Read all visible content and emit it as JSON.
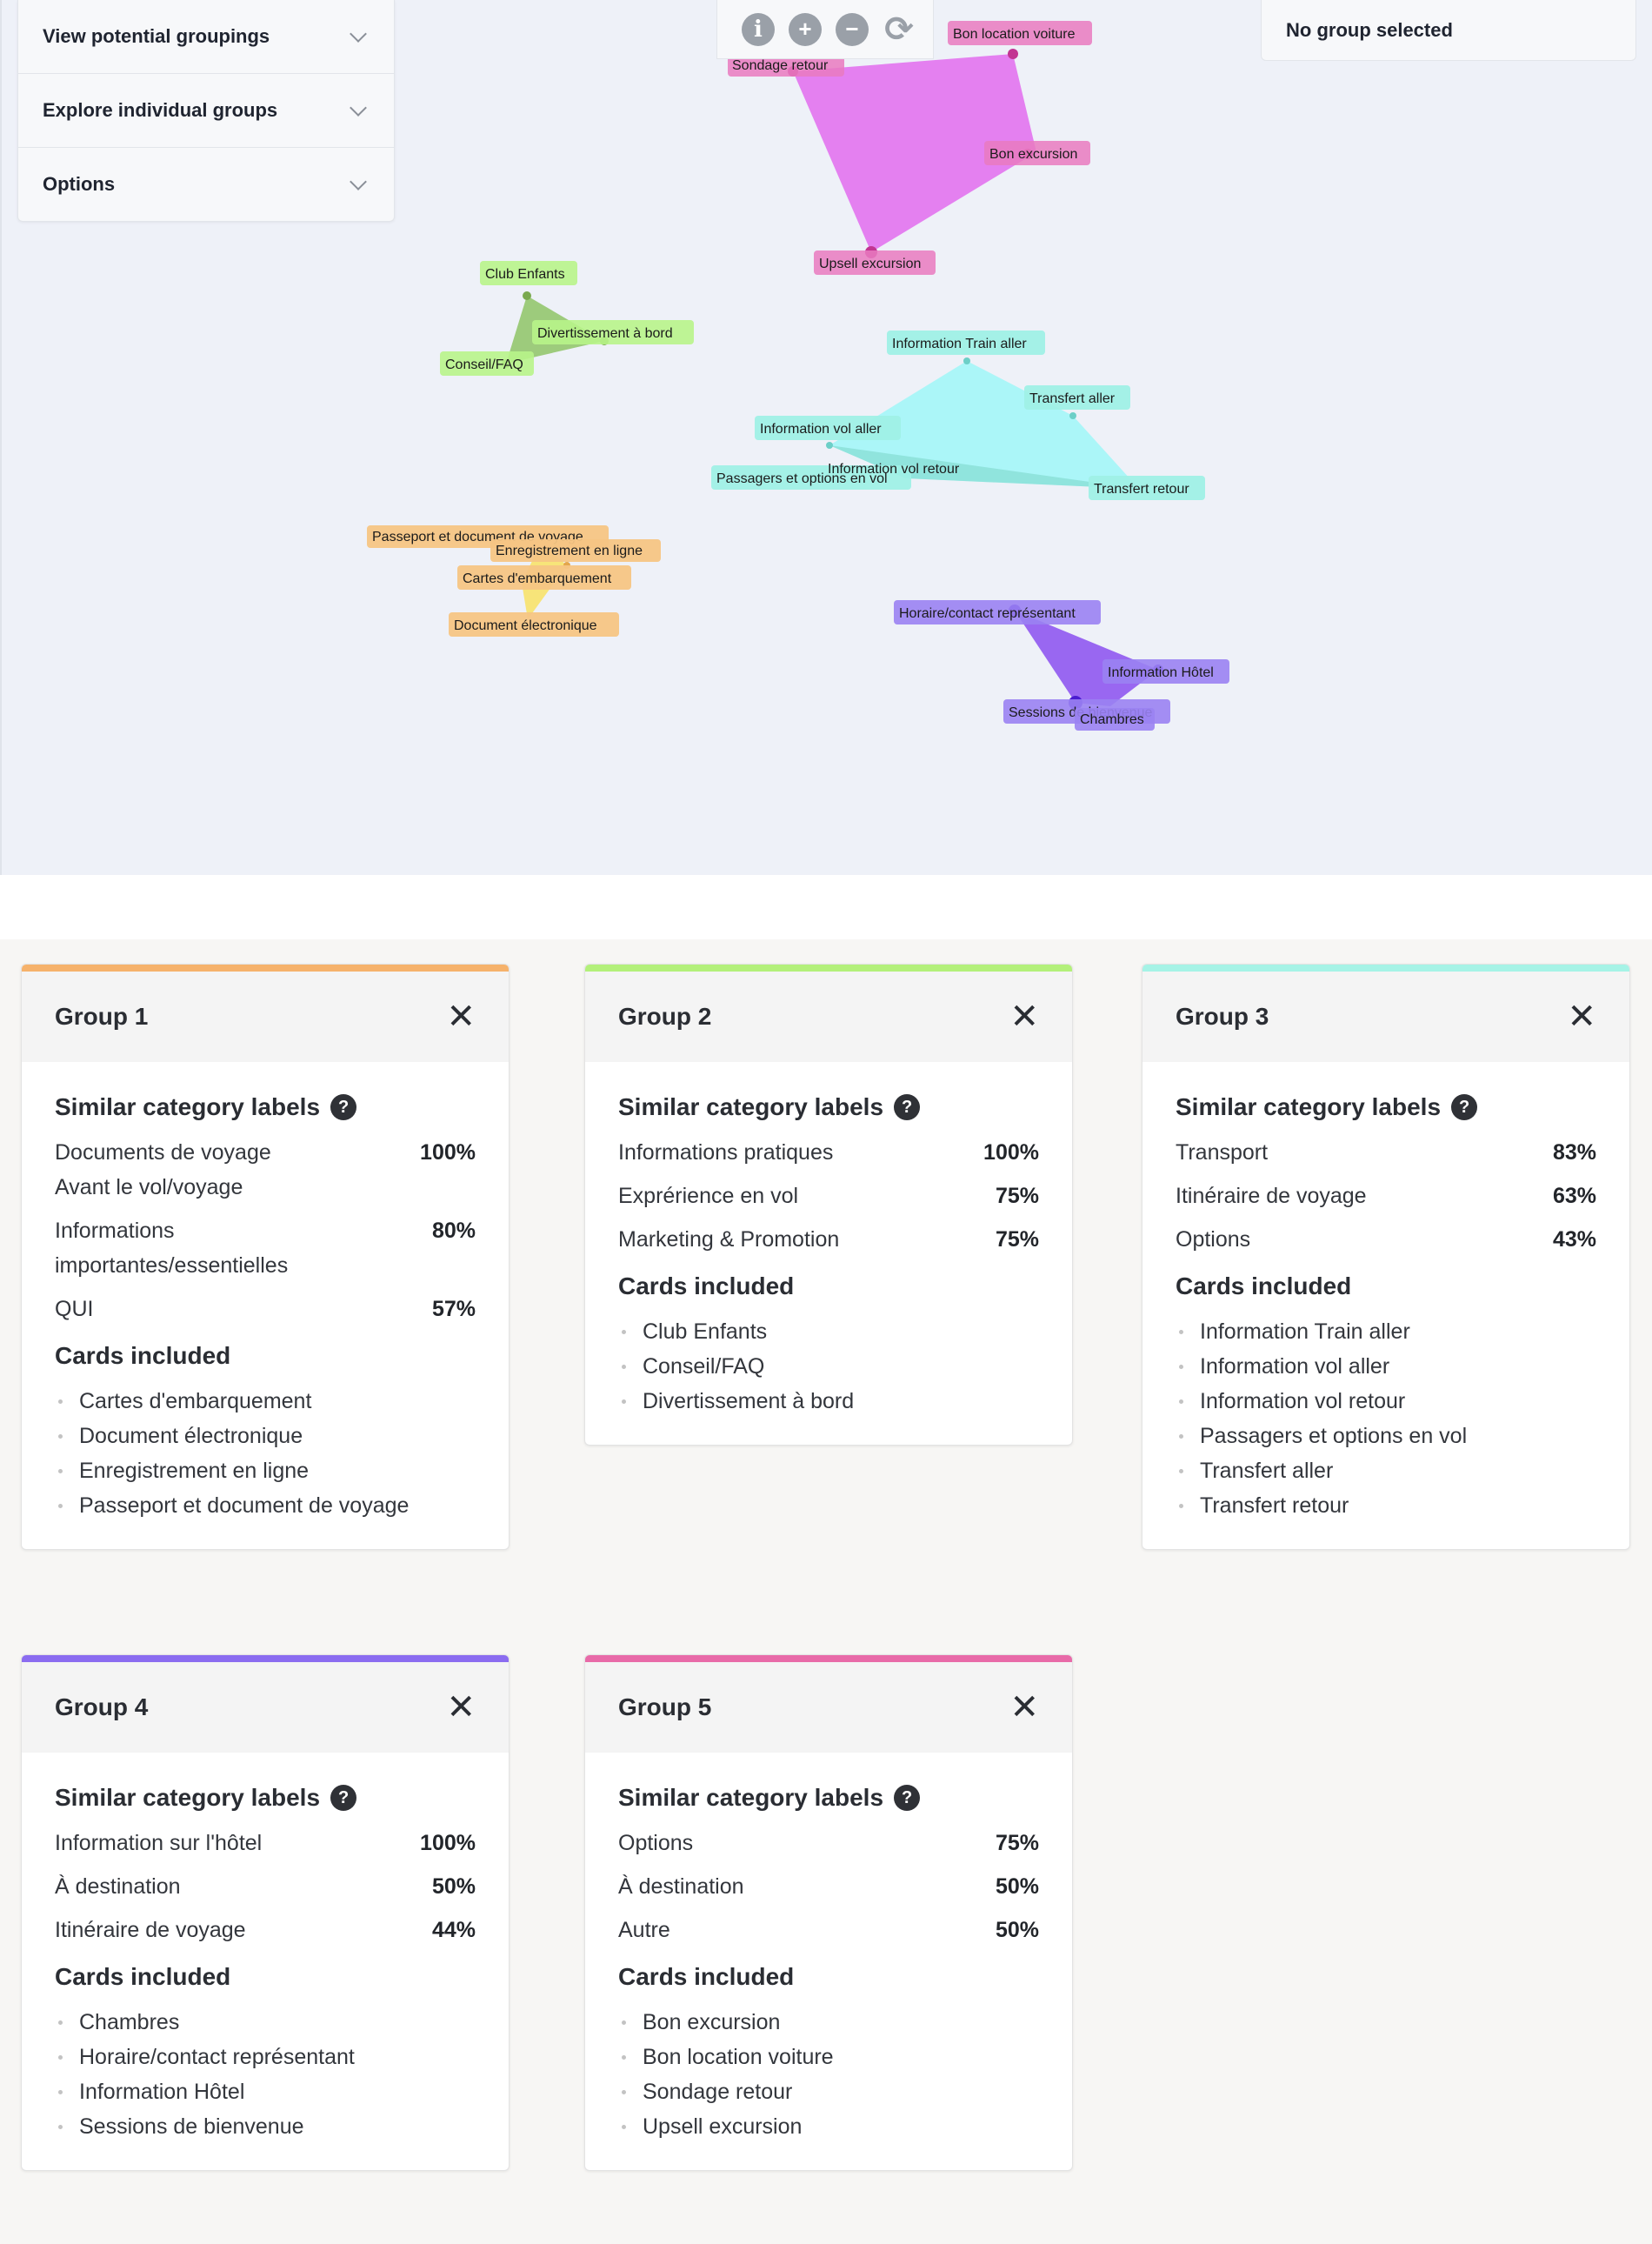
{
  "side_panel": {
    "items": [
      {
        "label": "View potential groupings"
      },
      {
        "label": "Explore individual groups"
      },
      {
        "label": "Options"
      }
    ]
  },
  "toolbar": {
    "info_icon": "info-icon",
    "zoom_in_icon": "plus-icon",
    "zoom_out_icon": "minus-icon",
    "reset_icon": "refresh-icon"
  },
  "status": {
    "text": "No group selected"
  },
  "graph": {
    "labels": {
      "sondage_retour": "Sondage retour",
      "bon_location_voiture": "Bon location voiture",
      "bon_excursion": "Bon excursion",
      "upsell_excursion": "Upsell excursion",
      "club_enfants": "Club Enfants",
      "divertissement": "Divertissement à bord",
      "conseil_faq": "Conseil/FAQ",
      "info_train_aller": "Information Train aller",
      "transfert_aller": "Transfert aller",
      "info_vol_aller": "Information vol aller",
      "info_vol_retour": "Information vol retour",
      "passagers": "Passagers et options en vol",
      "transfert_retour": "Transfert retour",
      "passeport": "Passeport et document de voyage",
      "enregistrement": "Enregistrement en ligne",
      "cartes_embarquement": "Cartes d'embarquement",
      "document_electronique": "Document électronique",
      "horaire_contact": "Horaire/contact représentant",
      "info_hotel": "Information Hôtel",
      "sessions_bienvenue": "Sessions de bienvenue",
      "chambres": "Chambres"
    }
  },
  "common": {
    "similar_labels_title": "Similar category labels",
    "cards_included_title": "Cards included",
    "help_icon": "?",
    "close_icon": "✕"
  },
  "groups": [
    {
      "title": "Group 1",
      "color": "#f6b26b",
      "labels": [
        {
          "name": "Documents de voyage Avant le vol/voyage",
          "pct": "100%"
        },
        {
          "name": "Informations importantes/essentielles",
          "pct": "80%"
        },
        {
          "name": "QUI",
          "pct": "57%"
        }
      ],
      "cards": [
        "Cartes d'embarquement",
        "Document électronique",
        "Enregistrement en ligne",
        "Passeport et document de voyage"
      ]
    },
    {
      "title": "Group 2",
      "color": "#b3f07a",
      "labels": [
        {
          "name": "Informations pratiques",
          "pct": "100%"
        },
        {
          "name": "Exprérience en vol",
          "pct": "75%"
        },
        {
          "name": "Marketing & Promotion",
          "pct": "75%"
        }
      ],
      "cards": [
        "Club Enfants",
        "Conseil/FAQ",
        "Divertissement à bord"
      ]
    },
    {
      "title": "Group 3",
      "color": "#a6f3e6",
      "labels": [
        {
          "name": "Transport",
          "pct": "83%"
        },
        {
          "name": "Itinéraire de voyage",
          "pct": "63%"
        },
        {
          "name": "Options",
          "pct": "43%"
        }
      ],
      "cards": [
        "Information Train aller",
        "Information vol aller",
        "Information vol retour",
        "Passagers et options en vol",
        "Transfert aller",
        "Transfert retour"
      ]
    },
    {
      "title": "Group 4",
      "color": "#8b6cf0",
      "labels": [
        {
          "name": "Information sur l'hôtel",
          "pct": "100%"
        },
        {
          "name": "À destination",
          "pct": "50%"
        },
        {
          "name": "Itinéraire de voyage",
          "pct": "44%"
        }
      ],
      "cards": [
        "Chambres",
        "Horaire/contact représentant",
        "Information Hôtel",
        "Sessions de bienvenue"
      ]
    },
    {
      "title": "Group 5",
      "color": "#e86aa8",
      "labels": [
        {
          "name": "Options",
          "pct": "75%"
        },
        {
          "name": "À destination",
          "pct": "50%"
        },
        {
          "name": "Autre",
          "pct": "50%"
        }
      ],
      "cards": [
        "Bon excursion",
        "Bon location voiture",
        "Sondage retour",
        "Upsell excursion"
      ]
    }
  ]
}
